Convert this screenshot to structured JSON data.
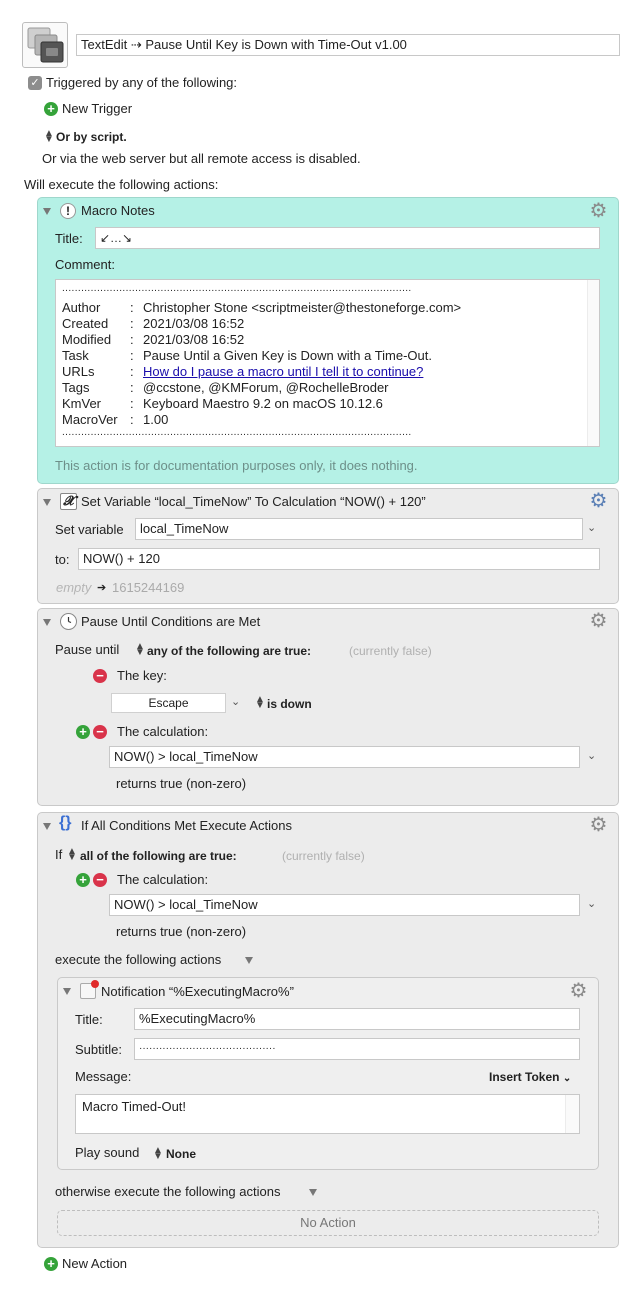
{
  "header": {
    "macro_title": "TextEdit ⇢ Pause Until Key is Down with Time-Out v1.00"
  },
  "triggers": {
    "checkbox_label": "Triggered by any of the following:",
    "new_trigger": "New Trigger",
    "or_by_script": "Or by script.",
    "web_server_note": "Or via the web server but all remote access is disabled.",
    "will_execute": "Will execute the following actions:"
  },
  "notes": {
    "title": "Macro Notes",
    "title_label": "Title:",
    "title_value": "↙…↘",
    "comment_label": "Comment:",
    "dots": "..............................................................................................................",
    "rows": [
      {
        "k": "Author",
        "v": "Christopher Stone <scriptmeister@thestoneforge.com>"
      },
      {
        "k": "Created",
        "v": "2021/03/08 16:52"
      },
      {
        "k": "Modified",
        "v": "2021/03/08 16:52"
      },
      {
        "k": "Task",
        "v": "Pause Until a Given Key is Down with a Time-Out."
      },
      {
        "k": "URLs",
        "v": "How do I pause a macro until I tell it to continue?"
      },
      {
        "k": "Tags",
        "v": "@ccstone, @KMForum, @RochelleBroder"
      },
      {
        "k": "KmVer",
        "v": "Keyboard Maestro 9.2 on macOS 10.12.6"
      },
      {
        "k": "MacroVer",
        "v": "1.00"
      }
    ],
    "colon": ":",
    "footer": "This action is for documentation purposes only, it does nothing."
  },
  "setvar": {
    "title": "Set Variable “local_TimeNow” To Calculation “NOW() + 120”",
    "set_label": "Set variable",
    "var_value": "local_TimeNow",
    "to_label": "to:",
    "to_value": "NOW() + 120",
    "empty": "empty",
    "arrow": "➔",
    "result": "1615244169"
  },
  "pause": {
    "title": "Pause Until Conditions are Met",
    "until_label": "Pause until",
    "mode": "any of the following are true:",
    "status": "(currently false)",
    "key_label": "The key:",
    "key_value": "Escape",
    "key_state": "is down",
    "calc_label": "The calculation:",
    "calc_value": "NOW() > local_TimeNow",
    "returns": "returns true (non-zero)"
  },
  "ifthen": {
    "title": "If All Conditions Met Execute Actions",
    "if_label": "If",
    "mode": "all of the following are true:",
    "status": "(currently false)",
    "calc_label": "The calculation:",
    "calc_value": "NOW() > local_TimeNow",
    "returns": "returns true (non-zero)",
    "execute_label": "execute the following actions",
    "otherwise_label": "otherwise execute the following actions",
    "no_action": "No Action"
  },
  "notify": {
    "title": "Notification “%ExecutingMacro%”",
    "title_label": "Title:",
    "title_value": "%ExecutingMacro%",
    "subtitle_label": "Subtitle:",
    "subtitle_value": "·········································",
    "message_label": "Message:",
    "insert_token": "Insert Token",
    "message_value": "Macro Timed-Out!",
    "sound_label": "Play sound",
    "sound_value": "None"
  },
  "footer": {
    "new_action": "New Action"
  },
  "colors": {
    "notes_bg": "#b5f1e6",
    "link": "#1a0dab",
    "add_green": "#35a33a",
    "remove_red": "#d9334a"
  }
}
